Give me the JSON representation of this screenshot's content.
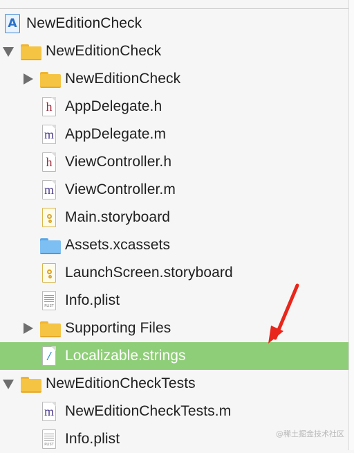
{
  "project": {
    "label": "NewEditionCheck",
    "icon": "xcode-project-icon"
  },
  "tree": [
    {
      "label": "NewEditionCheck",
      "icon": "folder",
      "disclosure": "down"
    },
    {
      "label": "NewEditionCheck",
      "icon": "folder",
      "disclosure": "right"
    },
    {
      "label": "AppDelegate.h",
      "icon": "h",
      "glyph": "h"
    },
    {
      "label": "AppDelegate.m",
      "icon": "m",
      "glyph": "m"
    },
    {
      "label": "ViewController.h",
      "icon": "h",
      "glyph": "h"
    },
    {
      "label": "ViewController.m",
      "icon": "m",
      "glyph": "m"
    },
    {
      "label": "Main.storyboard",
      "icon": "storyboard"
    },
    {
      "label": "Assets.xcassets",
      "icon": "assets-folder"
    },
    {
      "label": "LaunchScreen.storyboard",
      "icon": "storyboard"
    },
    {
      "label": "Info.plist",
      "icon": "plist",
      "plist_tag": "PLIST"
    },
    {
      "label": "Supporting Files",
      "icon": "folder",
      "disclosure": "right"
    },
    {
      "label": "Localizable.strings",
      "icon": "strings",
      "selected": true
    },
    {
      "label": "NewEditionCheckTests",
      "icon": "folder",
      "disclosure": "down"
    },
    {
      "label": "NewEditionCheckTests.m",
      "icon": "m",
      "glyph": "m"
    },
    {
      "label": "Info.plist",
      "icon": "plist",
      "plist_tag": "PLIST"
    }
  ],
  "colors": {
    "selection": "#8fce78",
    "annotation_arrow": "#e8261b"
  },
  "watermark": "@稀土掘金技术社区"
}
